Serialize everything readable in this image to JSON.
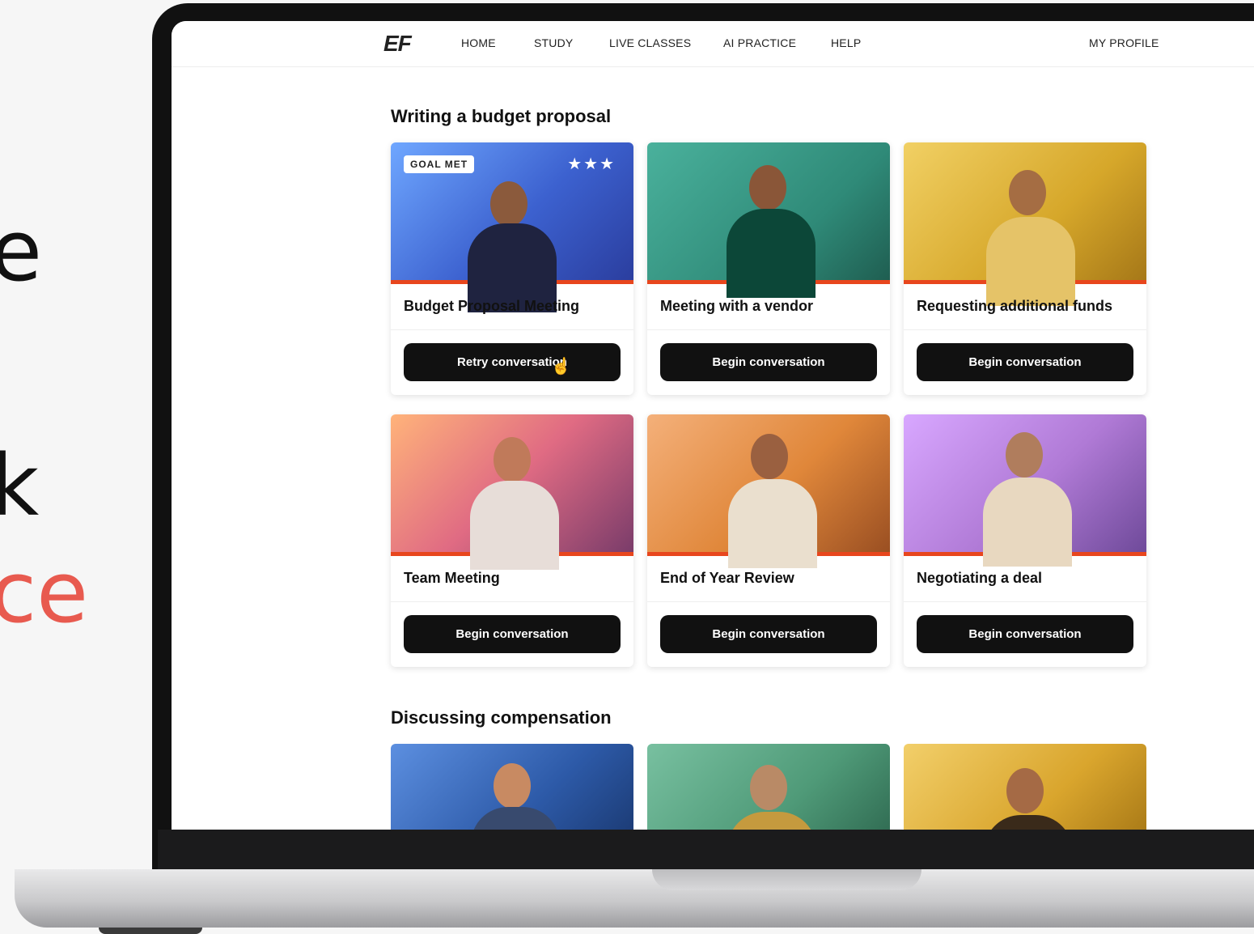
{
  "slide": {
    "fragments": [
      "e",
      "k",
      "ce"
    ]
  },
  "nav": {
    "logo": "EF",
    "items": [
      "HOME",
      "STUDY",
      "LIVE CLASSES",
      "AI PRACTICE",
      "HELP"
    ],
    "profile": "MY PROFILE"
  },
  "sections": [
    {
      "title": "Writing a budget proposal",
      "cards": [
        {
          "title": "Budget Proposal Meeting",
          "button": "Retry conversation",
          "badge": "GOAL MET",
          "stars": "★★★",
          "bg": "#3f63d0"
        },
        {
          "title": "Meeting with a vendor",
          "button": "Begin conversation",
          "bg": "#2f8a78"
        },
        {
          "title": "Requesting additional funds",
          "button": "Begin conversation",
          "bg": "#d6a72a"
        },
        {
          "title": "Team Meeting",
          "button": "Begin conversation",
          "bg": "#d65a78"
        },
        {
          "title": "End of Year Review",
          "button": "Begin conversation",
          "bg": "#e0873a"
        },
        {
          "title": "Negotiating a deal",
          "button": "Begin conversation",
          "bg": "#b07ad6"
        }
      ]
    },
    {
      "title": "Discussing compensation",
      "cards": [
        {
          "bg": "#2d5aa8"
        },
        {
          "bg": "#4f9a78"
        },
        {
          "bg": "#d9a52d"
        }
      ]
    }
  ],
  "colors": {
    "accent": "#e8461d",
    "button": "#111111"
  }
}
